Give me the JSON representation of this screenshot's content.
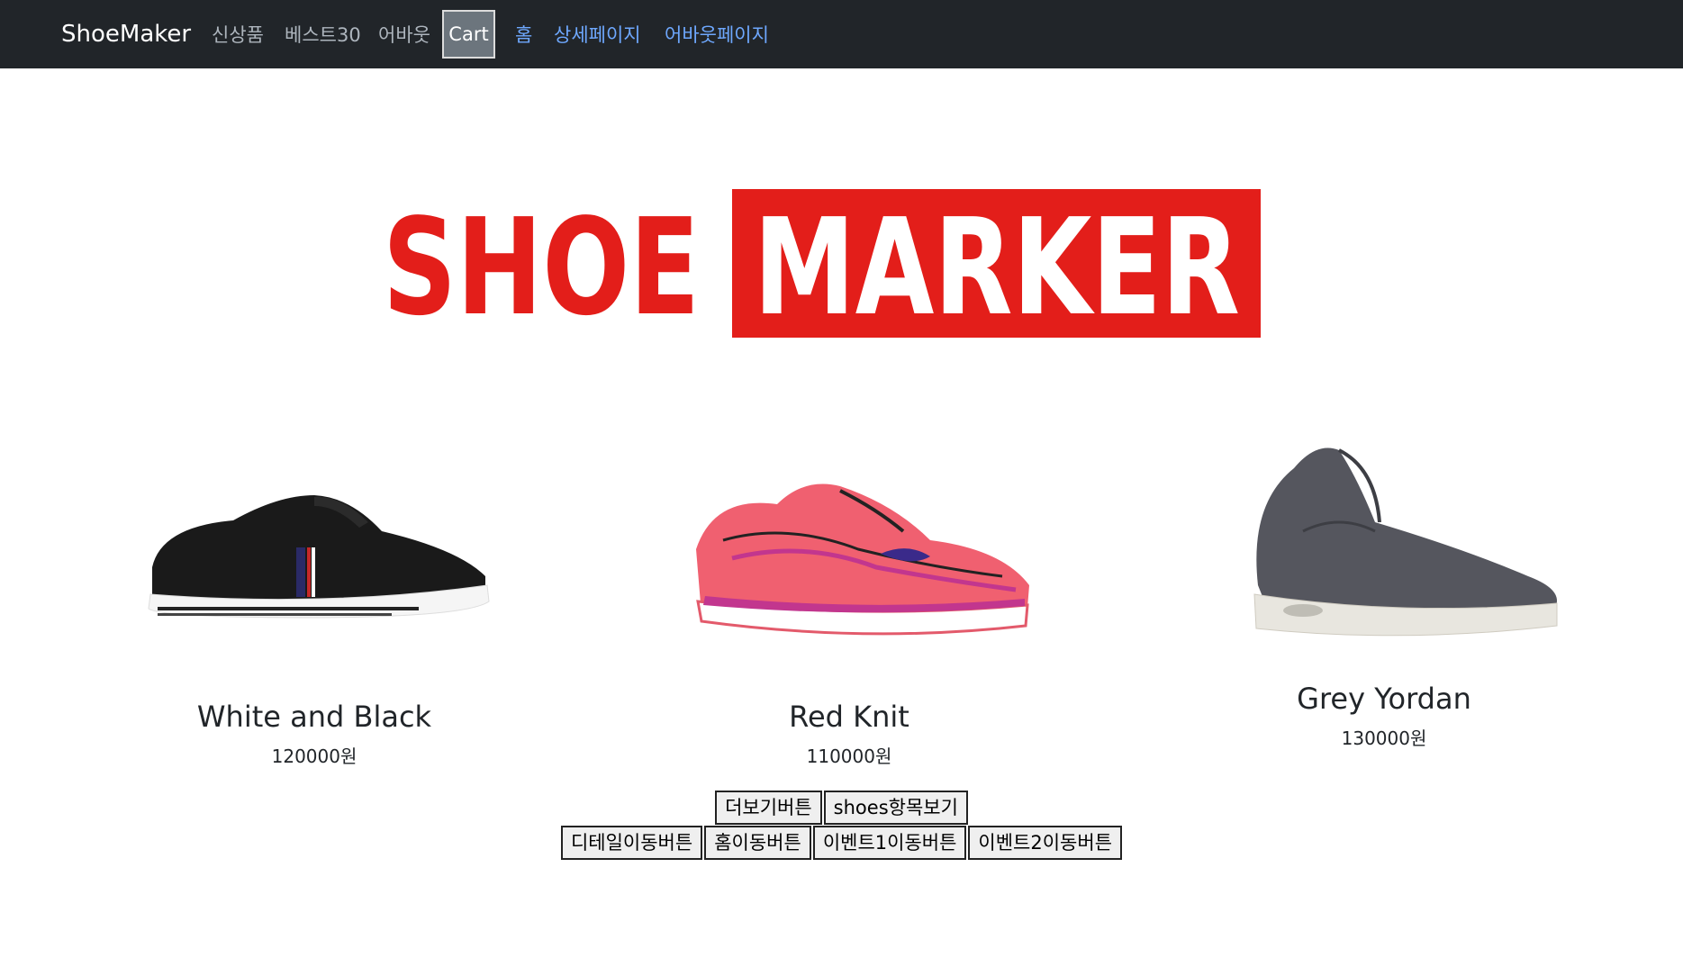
{
  "navbar": {
    "brand": "ShoeMaker",
    "links": [
      "신상품",
      "베스트30",
      "어바웃"
    ],
    "cart_label": "Cart",
    "router_links": [
      "홈",
      "상세페이지",
      "어바웃페이지"
    ]
  },
  "hero": {
    "logo_left": "SHOE",
    "logo_right": "MARKER",
    "logo_color": "#e31e1a"
  },
  "products": [
    {
      "name": "White and Black",
      "price": "120000원"
    },
    {
      "name": "Red Knit",
      "price": "110000원"
    },
    {
      "name": "Grey Yordan",
      "price": "130000원"
    }
  ],
  "buttons": {
    "more": "더보기버튼",
    "shoes_list": "shoes항목보기",
    "detail": "디테일이동버튼",
    "home": "홈이동버튼",
    "event1": "이벤트1이동버튼",
    "event2": "이벤트2이동버튼"
  },
  "colors": {
    "navbar_bg": "#212529",
    "link_muted": "#adb5bd",
    "link_blue": "#6ea8fe"
  }
}
